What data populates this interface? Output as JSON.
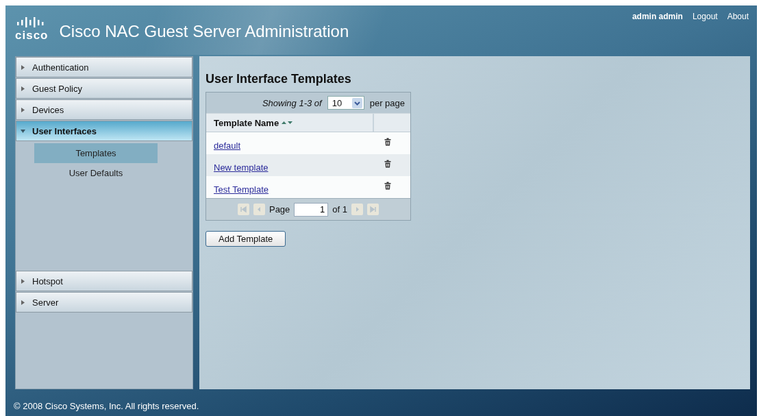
{
  "header": {
    "logo": "cisco",
    "title": "Cisco NAC Guest Server Administration",
    "user": "admin admin",
    "links": [
      "Logout",
      "About"
    ]
  },
  "sidebar": {
    "items": [
      {
        "label": "Authentication",
        "expanded": false
      },
      {
        "label": "Guest Policy",
        "expanded": false
      },
      {
        "label": "Devices",
        "expanded": false
      },
      {
        "label": "User Interfaces",
        "expanded": true,
        "children": [
          {
            "label": "Templates",
            "selected": true
          },
          {
            "label": "User Defaults",
            "selected": false
          }
        ]
      },
      {
        "label": "Hotspot",
        "expanded": false
      },
      {
        "label": "Server",
        "expanded": false
      }
    ]
  },
  "content": {
    "heading": "User Interface Templates",
    "table": {
      "showing": "Showing 1-3 of",
      "per_page": "10",
      "per_page_suffix": "per page",
      "column": "Template Name",
      "rows": [
        {
          "name": "default"
        },
        {
          "name": "New template"
        },
        {
          "name": "Test Template"
        }
      ],
      "pager": {
        "page_label": "Page",
        "page": "1",
        "of": "of 1"
      }
    },
    "button": "Add Template"
  },
  "footer": "© 2008 Cisco Systems, Inc. All rights reserved."
}
